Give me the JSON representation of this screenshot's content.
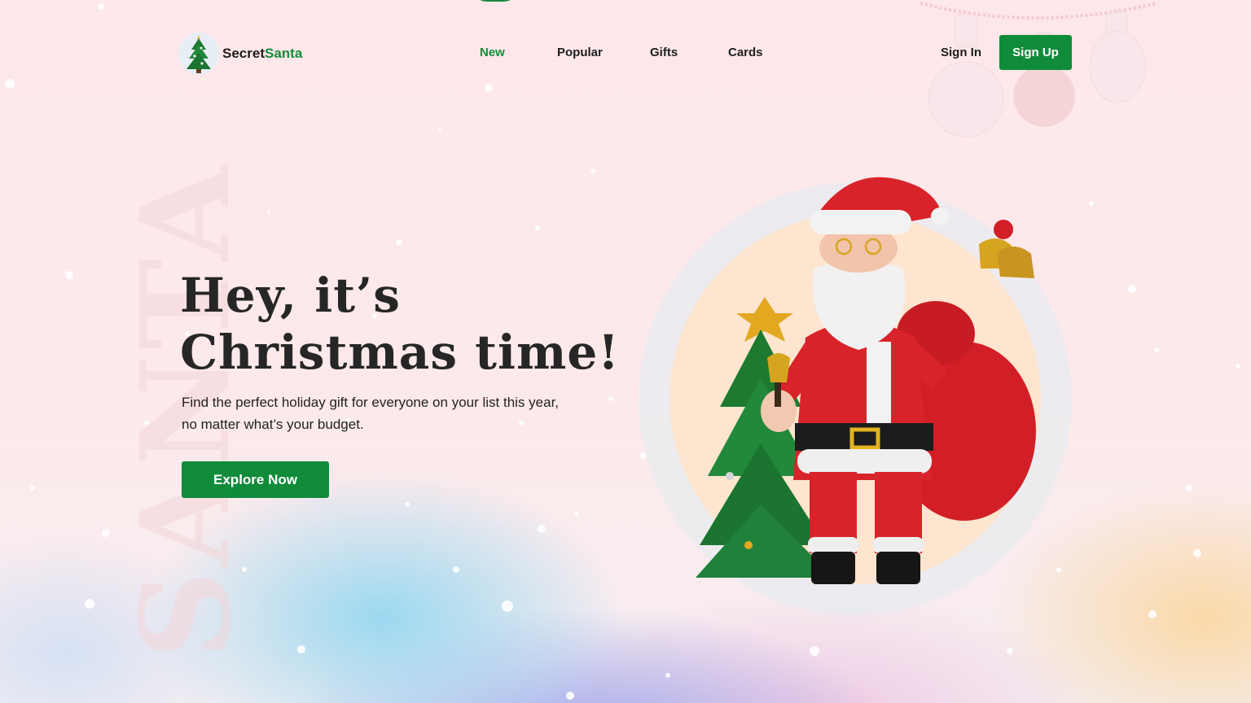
{
  "brand": {
    "name_part1": "Secret",
    "name_part2": "Santa",
    "accent_color": "#148c3a"
  },
  "nav": {
    "links": [
      {
        "label": "New",
        "active": true
      },
      {
        "label": "Popular",
        "active": false
      },
      {
        "label": "Gifts",
        "active": false
      },
      {
        "label": "Cards",
        "active": false
      }
    ],
    "sign_in": "Sign In",
    "sign_up": "Sign Up"
  },
  "hero": {
    "title_line1": "Hey, it’s",
    "title_line2": "Christmas time!",
    "subtitle": "Find the perfect holiday gift for everyone on your list this year, no matter what’s your budget.",
    "cta": "Explore Now"
  },
  "decor": {
    "watermark_text": "SANTA"
  },
  "colors": {
    "primary_button": "#0f8b3a",
    "background_top": "#fde7ea",
    "santa_red": "#d9232a"
  }
}
